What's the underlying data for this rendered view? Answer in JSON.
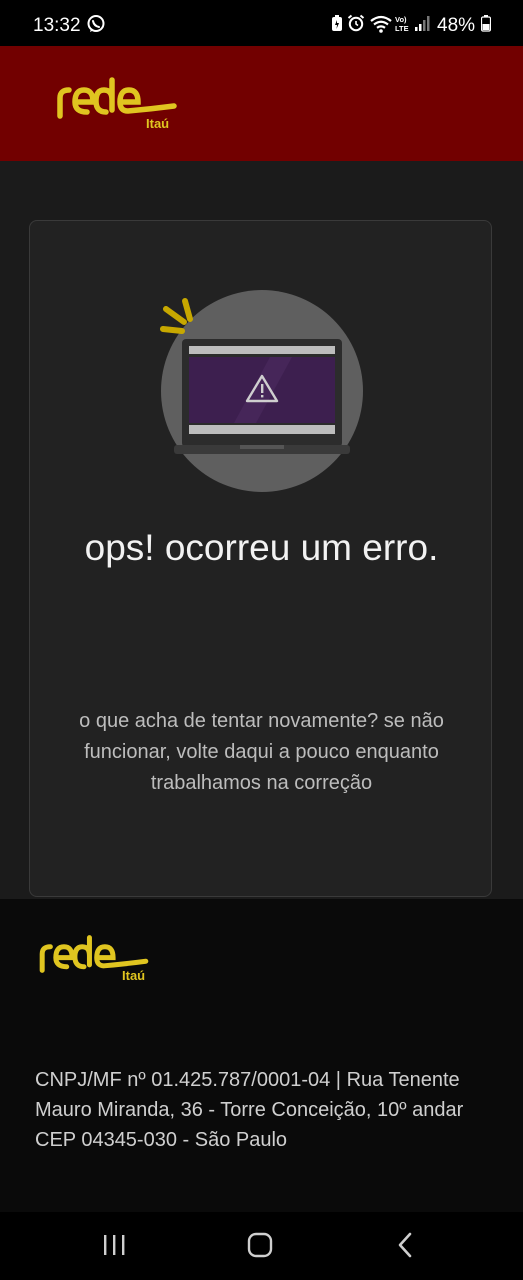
{
  "status_bar": {
    "time": "13:32",
    "battery_percent": "48%",
    "icons": [
      "whatsapp-icon",
      "battery-saver-icon",
      "alarm-icon",
      "wifi-icon",
      "volte-icon",
      "signal-icon",
      "battery-icon"
    ]
  },
  "header": {
    "logo_text": "rede",
    "logo_sub": "Itaú"
  },
  "error": {
    "illustration": "laptop-warning-icon",
    "title": "ops! ocorreu um erro.",
    "message": "o que acha de tentar novamente? se não funcionar, volte daqui a pouco enquanto trabalhamos na correção"
  },
  "footer": {
    "logo_text": "rede",
    "logo_sub": "Itaú",
    "address": "CNPJ/MF nº 01.425.787/0001-04 | Rua Tenente Mauro Miranda, 36 - Torre Conceição, 10º andar CEP 04345-030 - São Paulo"
  },
  "nav_bar": {
    "buttons": [
      "recent-apps-icon",
      "home-icon",
      "back-icon"
    ]
  },
  "colors": {
    "header_bg": "#720000",
    "brand_yellow": "#e0c520",
    "card_bg": "#222222",
    "page_bg": "#1b1b1b",
    "footer_bg": "#0a0a0a",
    "screen_purple": "#3d1f4f"
  }
}
